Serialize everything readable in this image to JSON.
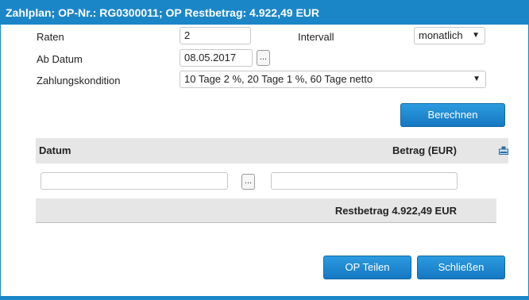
{
  "window": {
    "title": "Zahlplan; OP-Nr.: RG0300011; OP Restbetrag: 4.922,49 EUR"
  },
  "form": {
    "raten_label": "Raten",
    "raten_value": "2",
    "intervall_label": "Intervall",
    "intervall_value": "monatlich",
    "ab_datum_label": "Ab Datum",
    "ab_datum_value": "08.05.2017",
    "date_picker_label": "...",
    "zahlungskondition_label": "Zahlungskondition",
    "zahlungskondition_value": "10 Tage 2 %, 20 Tage 1 %, 60 Tage netto"
  },
  "buttons": {
    "berechnen": "Berechnen",
    "op_teilen": "OP Teilen",
    "schliessen": "Schließen"
  },
  "table": {
    "columns": [
      "Datum",
      "Betrag (EUR)"
    ],
    "row": {
      "datum": "",
      "row_picker_label": "...",
      "betrag": ""
    },
    "restbetrag_text": "Restbetrag 4.922,49 EUR"
  },
  "icons": {
    "caret": "chevron-down-icon",
    "export": "export-icon"
  },
  "colors": {
    "accent": "#1a86c8",
    "button_top": "#2c9be0",
    "button_bottom": "#1578c2",
    "table_header_bg": "#e6e6e6"
  }
}
